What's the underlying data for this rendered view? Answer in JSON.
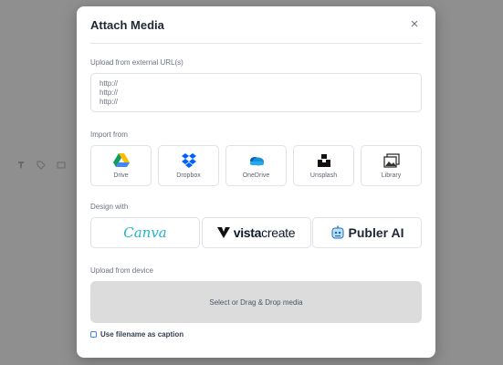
{
  "modal": {
    "title": "Attach Media",
    "close_glyph": "×"
  },
  "urls": {
    "label": "Upload from external URL(s)",
    "lines": [
      "http://",
      "http://",
      "http://"
    ]
  },
  "import": {
    "label": "Import from",
    "items": [
      {
        "label": "Drive",
        "icon": "google-drive-icon"
      },
      {
        "label": "Dropbox",
        "icon": "dropbox-icon"
      },
      {
        "label": "OneDrive",
        "icon": "onedrive-icon"
      },
      {
        "label": "Unsplash",
        "icon": "unsplash-icon"
      },
      {
        "label": "Library",
        "icon": "library-icon"
      }
    ]
  },
  "design": {
    "label": "Design with",
    "canva": "Canva",
    "vista_prefix": "vista",
    "vista_suffix": "create",
    "publer": "Publer AI"
  },
  "device": {
    "label": "Upload from device",
    "dropzone": "Select or Drag & Drop media",
    "caption_checkbox": "Use filename as caption",
    "caption_checked": false
  },
  "colors": {
    "accent": "#3b82f6",
    "canva": "#22b5c7",
    "dropbox": "#0061fe",
    "onedrive": "#0f78d4"
  }
}
